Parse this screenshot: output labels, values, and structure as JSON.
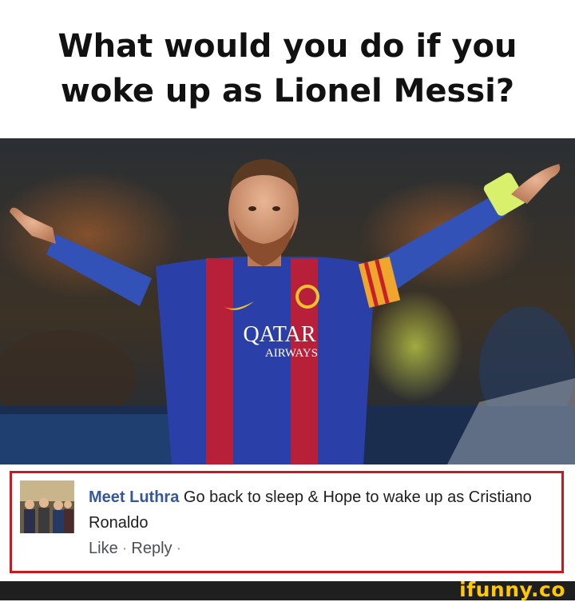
{
  "meme": {
    "title_line1": "What would you do if you",
    "title_line2": "woke up as Lionel Messi?"
  },
  "photo": {
    "sponsor_line1": "QATAR",
    "sponsor_line2": "AIRWAYS"
  },
  "comment": {
    "author": "Meet Luthra",
    "text": "Go back to sleep & Hope to wake up as Cristiano Ronaldo",
    "like_label": "Like",
    "reply_label": "Reply",
    "separator": "·",
    "border_color": "#c8191e",
    "author_color": "#365899"
  },
  "footer": {
    "brand": "ifunny.co",
    "brand_color": "#ffc800"
  }
}
